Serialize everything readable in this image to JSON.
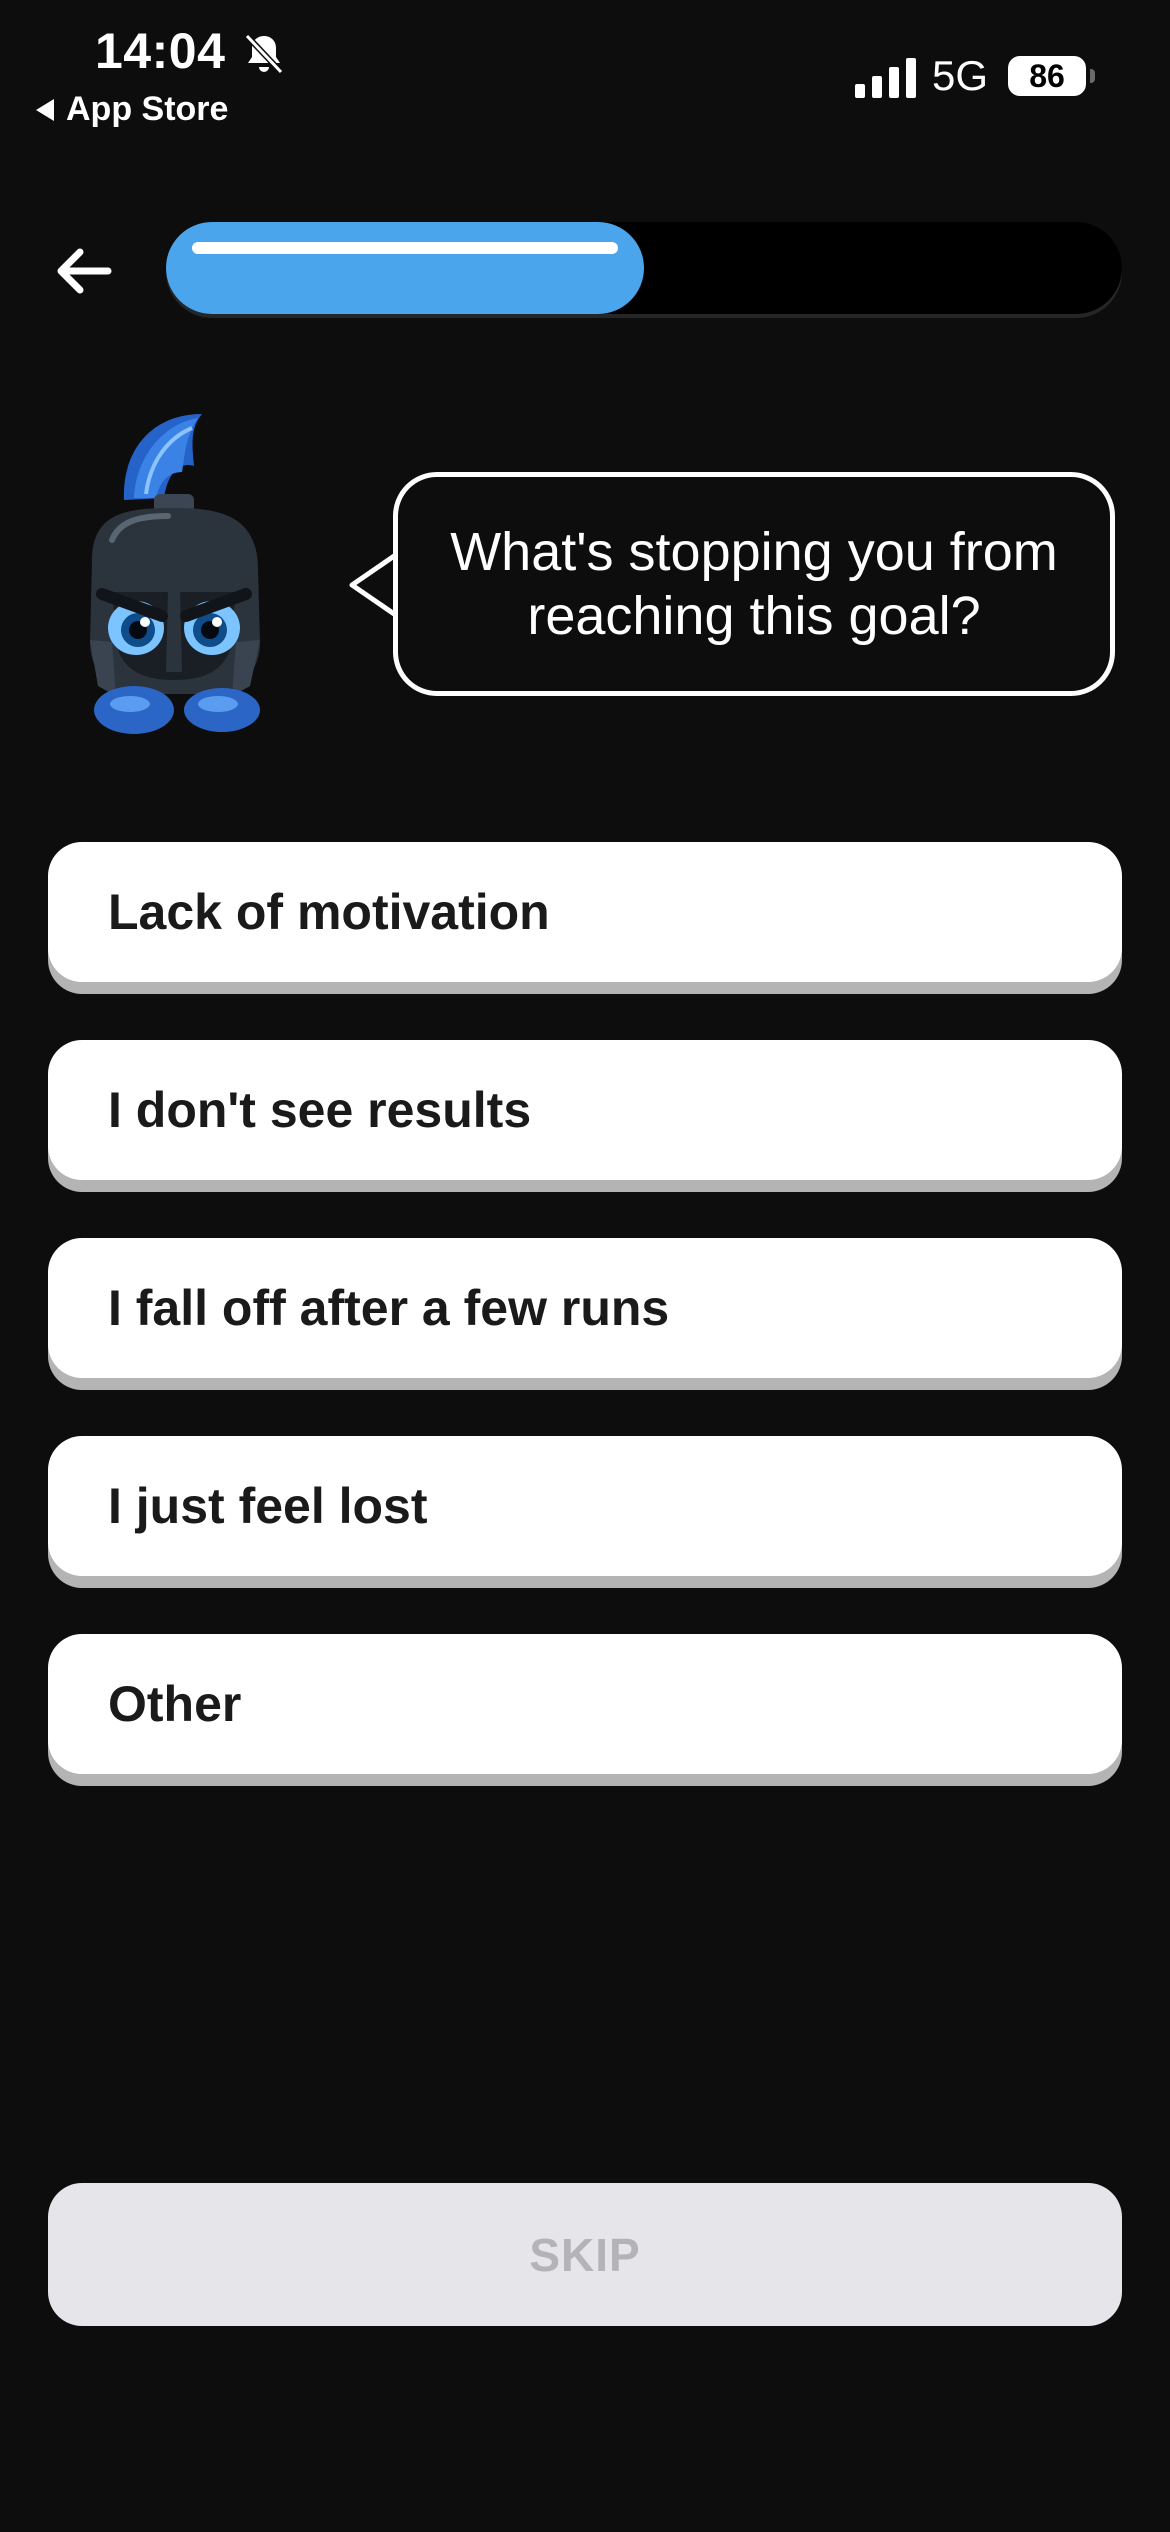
{
  "status_bar": {
    "time": "14:04",
    "back_app_label": "App Store",
    "network": "5G",
    "battery": "86",
    "icons": [
      "bell-slash-icon",
      "signal-bars-icon",
      "battery-icon"
    ]
  },
  "header": {
    "back_icon": "arrow-left-icon",
    "progress_fraction": 0.5
  },
  "prompt": {
    "mascot": "spartan-helmet-mascot",
    "question": "What's stopping you from reaching this goal?"
  },
  "options": [
    {
      "label": "Lack of motivation"
    },
    {
      "label": "I don't see results"
    },
    {
      "label": "I fall off after a few runs"
    },
    {
      "label": "I just feel lost"
    },
    {
      "label": "Other"
    }
  ],
  "footer": {
    "skip_label": "SKIP"
  },
  "colors": {
    "background": "#0d0d0d",
    "progress": "#4aa5ec",
    "option_bg": "#ffffff",
    "option_text": "#1a1a1a",
    "skip_bg": "#e5e5ea",
    "skip_text": "#b3b3b8"
  }
}
